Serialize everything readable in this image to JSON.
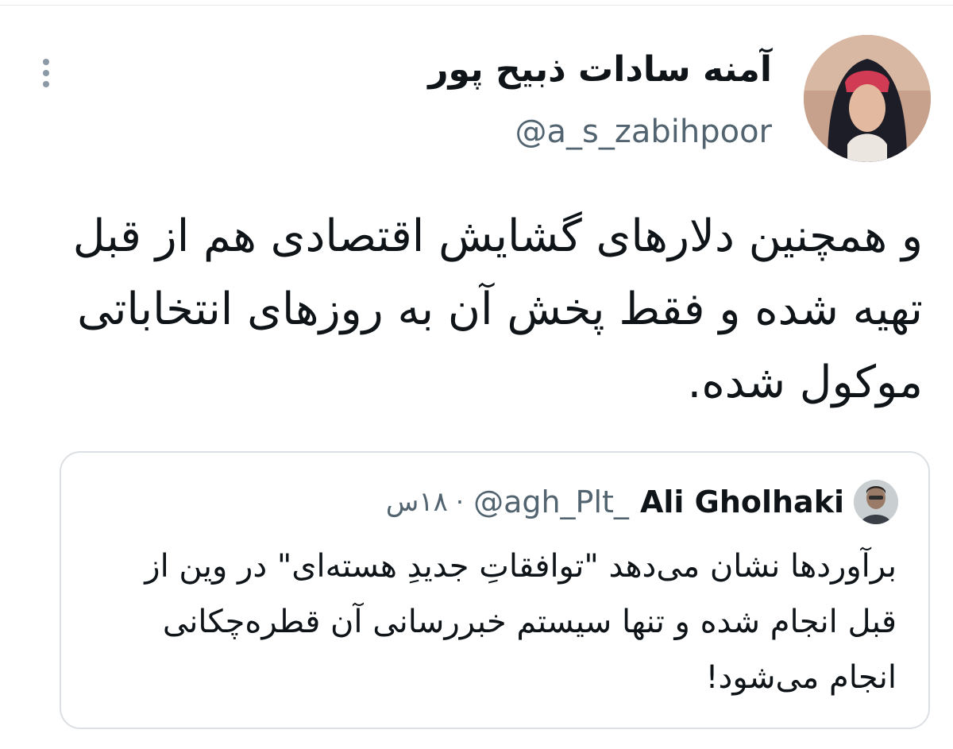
{
  "tweet": {
    "author_name": "آمنه سادات ذبیح پور",
    "author_handle": "@a_s_zabihpoor",
    "avatar_icon": "user-avatar-icon",
    "more_icon": "more-vertical-icon",
    "text": "و همچنین دلارهای گشایش اقتصادی هم از قبل تهیه شده و فقط پخش آن به روزهای انتخاباتی موکول شده."
  },
  "quoted_tweet": {
    "author_name": "Ali Gholhaki",
    "author_handle": "@agh_Plt_",
    "separator": "·",
    "time": "۱۸س",
    "text": "برآوردها نشان می‌دهد \"توافقاتِ جدیدِ هسته‌ای\" در وین از قبل انجام شده و تنها سیستم خبررسانی آن قطره‌چکانی انجام می‌شود!"
  },
  "colors": {
    "text_primary": "#0f1419",
    "text_secondary": "#536471",
    "border": "#dcdfe3"
  }
}
